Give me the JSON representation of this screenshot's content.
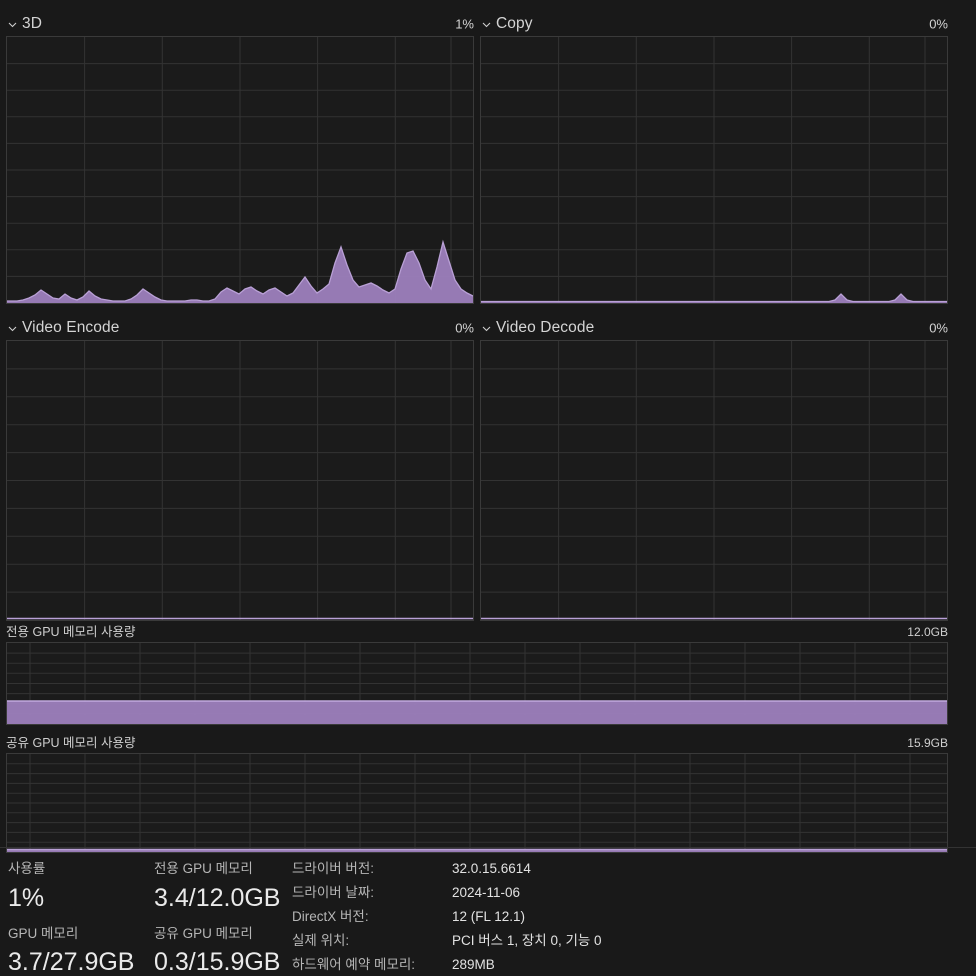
{
  "theme": {
    "background": "#191919",
    "graph_background": "#1b1b1b",
    "graph_border": "#3a3a3a",
    "grid_line": "#333333",
    "accent_fill": "#9d80bd",
    "accent_stroke": "#b9a0d6",
    "text_primary": "#e2e2e2",
    "text_secondary": "#b6b6b6"
  },
  "panels": [
    {
      "id": "3d",
      "icon": "chevron-down-icon",
      "title": "3D",
      "value": "1%"
    },
    {
      "id": "copy",
      "icon": "chevron-down-icon",
      "title": "Copy",
      "value": "0%"
    },
    {
      "id": "video-encode",
      "icon": "chevron-down-icon",
      "title": "Video Encode",
      "value": "0%"
    },
    {
      "id": "video-decode",
      "icon": "chevron-down-icon",
      "title": "Video Decode",
      "value": "0%"
    }
  ],
  "memory_sections": [
    {
      "id": "dedicated",
      "title": "전용 GPU 메모리 사용량",
      "value": "12.0GB"
    },
    {
      "id": "shared",
      "title": "공유 GPU 메모리 사용량",
      "value": "15.9GB"
    }
  ],
  "stats": [
    {
      "id": "utilization",
      "label": "사용률",
      "value": "1%"
    },
    {
      "id": "dedicated-memory",
      "label": "전용 GPU 메모리",
      "value": "3.4/12.0GB"
    },
    {
      "id": "gpu-memory",
      "label": "GPU 메모리",
      "value": "3.7/27.9GB"
    },
    {
      "id": "shared-memory",
      "label": "공유 GPU 메모리",
      "value": "0.3/15.9GB"
    }
  ],
  "details": [
    {
      "id": "driver-version",
      "label": "드라이버 버전:",
      "value": "32.0.15.6614"
    },
    {
      "id": "driver-date",
      "label": "드라이버 날짜:",
      "value": "2024-11-06"
    },
    {
      "id": "directx-version",
      "label": "DirectX 버전:",
      "value": "12 (FL 12.1)"
    },
    {
      "id": "physical-location",
      "label": "실제 위치:",
      "value": "PCI 버스 1, 장치 0, 기능 0"
    },
    {
      "id": "hardware-reserved",
      "label": "하드웨어 예약 메모리:",
      "value": "289MB"
    }
  ],
  "chart_data": [
    {
      "id": "3d",
      "type": "area",
      "title": "3D",
      "ylabel": "utilization %",
      "ylim": [
        0,
        100
      ],
      "current": 1,
      "grid": true,
      "grid_cols": 6,
      "grid_rows": 10,
      "values": [
        0,
        0,
        0,
        0,
        0,
        0,
        1,
        2,
        4,
        2,
        1,
        1,
        2,
        3,
        2,
        1,
        1,
        3,
        4,
        3,
        1,
        0,
        0,
        0,
        0,
        0,
        1,
        2,
        3,
        2,
        1,
        1,
        2,
        3,
        3,
        2,
        1,
        0,
        0,
        0,
        0,
        0,
        0,
        0,
        0,
        0,
        0,
        0,
        0,
        1,
        2,
        3,
        4,
        3,
        2,
        2,
        3,
        4,
        3,
        2,
        2,
        1,
        1,
        0,
        0,
        0,
        0,
        0,
        0,
        1,
        2,
        3,
        3,
        2,
        2,
        3,
        3,
        2,
        2,
        3,
        3,
        2,
        2,
        2,
        3,
        3,
        2,
        2,
        3,
        5,
        4,
        3,
        2,
        2,
        3,
        4,
        6,
        9,
        6,
        4,
        3,
        3,
        3,
        3,
        4,
        4,
        3,
        2,
        2,
        2,
        3,
        4,
        6,
        8,
        9,
        8,
        6,
        4,
        3,
        3,
        4,
        6,
        10,
        8,
        5,
        3,
        3,
        3,
        3,
        2,
        2,
        2,
        1,
        1
      ]
    },
    {
      "id": "copy",
      "type": "area",
      "title": "Copy",
      "ylabel": "utilization %",
      "ylim": [
        0,
        100
      ],
      "current": 0,
      "grid": true,
      "grid_cols": 6,
      "grid_rows": 10,
      "values": [
        0,
        0,
        0,
        0,
        0,
        0,
        0,
        0,
        0,
        0,
        0,
        0,
        0,
        0,
        0,
        0,
        0,
        0,
        0,
        0,
        0,
        0,
        0,
        0,
        0,
        0,
        0,
        0,
        0,
        0,
        0,
        0,
        0,
        0,
        0,
        0,
        0,
        0,
        0,
        0,
        0,
        0,
        0,
        0,
        0,
        0,
        0,
        0,
        0,
        0,
        0,
        0,
        0,
        0,
        0,
        0,
        0,
        0,
        0,
        0,
        0,
        0,
        0,
        0,
        0,
        0,
        0,
        0,
        0,
        0,
        0,
        0,
        0,
        0,
        0,
        0,
        0,
        0,
        0,
        0,
        0,
        0,
        0,
        0,
        0,
        0,
        0,
        0,
        0,
        0,
        0,
        0,
        0,
        0,
        0,
        0,
        0,
        0,
        0,
        0,
        0,
        0,
        0,
        0,
        0,
        0,
        0,
        0,
        0,
        0,
        0,
        0,
        0,
        0,
        0,
        1,
        2,
        1,
        0,
        0,
        0,
        0,
        0,
        0,
        0,
        1,
        2,
        1,
        0,
        0,
        0,
        0,
        0,
        0
      ]
    },
    {
      "id": "video-encode",
      "type": "area",
      "title": "Video Encode",
      "ylabel": "utilization %",
      "ylim": [
        0,
        100
      ],
      "current": 0,
      "grid": true,
      "grid_cols": 6,
      "grid_rows": 10,
      "values": [
        0,
        0,
        0,
        0,
        0,
        0,
        0,
        0,
        0,
        0,
        0,
        0,
        0,
        0,
        0,
        0,
        0,
        0,
        0,
        0,
        0,
        0,
        0,
        0,
        0,
        0,
        0,
        0,
        0,
        0,
        0,
        0,
        0,
        0,
        0,
        0,
        0,
        0,
        0,
        0,
        0,
        0,
        0,
        0,
        0,
        0,
        0,
        0,
        0,
        0,
        0,
        0,
        0,
        0,
        0,
        0,
        0,
        0,
        0,
        0,
        0,
        0,
        0,
        0,
        0,
        0,
        0,
        0,
        0,
        0,
        0,
        0,
        0,
        0,
        0,
        0,
        0,
        0,
        0,
        0,
        0,
        0,
        0,
        0,
        0,
        0,
        0,
        0,
        0,
        0,
        0,
        0,
        0,
        0,
        0,
        0,
        0,
        0,
        0,
        0,
        0,
        0,
        0,
        0,
        0,
        0,
        0,
        0,
        0,
        0,
        0,
        0,
        0,
        0,
        0,
        0,
        0,
        0,
        0,
        0,
        0,
        0,
        0,
        0,
        0,
        0,
        0,
        0
      ]
    },
    {
      "id": "video-decode",
      "type": "area",
      "title": "Video Decode",
      "ylabel": "utilization %",
      "ylim": [
        0,
        100
      ],
      "current": 0,
      "grid": true,
      "grid_cols": 6,
      "grid_rows": 10,
      "values": [
        0,
        0,
        0,
        0,
        0,
        0,
        0,
        0,
        0,
        0,
        0,
        0,
        0,
        0,
        0,
        0,
        0,
        0,
        0,
        0,
        0,
        0,
        0,
        0,
        0,
        0,
        0,
        0,
        0,
        0,
        0,
        0,
        0,
        0,
        0,
        0,
        0,
        0,
        0,
        0,
        0,
        0,
        0,
        0,
        0,
        0,
        0,
        0,
        0,
        0,
        0,
        0,
        0,
        0,
        0,
        0,
        0,
        0,
        0,
        0,
        0,
        0,
        0,
        0,
        0,
        0,
        0,
        0,
        0,
        0,
        0,
        0,
        0,
        0,
        0,
        0,
        0,
        0,
        0,
        0,
        0,
        0,
        0,
        0,
        0,
        0,
        0,
        0,
        0,
        0,
        0,
        0,
        0,
        0,
        0,
        0,
        0,
        0,
        0,
        0,
        0,
        0,
        0,
        0,
        0,
        0,
        0,
        0,
        0,
        0,
        0,
        0,
        0,
        0,
        0,
        0,
        0,
        0,
        0,
        0,
        0,
        0,
        0,
        0,
        0,
        0,
        0,
        0
      ]
    },
    {
      "id": "dedicated-memory",
      "type": "area",
      "title": "전용 GPU 메모리 사용량",
      "ylabel": "GB",
      "ylim": [
        0,
        12.0
      ],
      "current": 3.4,
      "fill_percent": 28.3,
      "grid": true,
      "grid_cols": 17,
      "grid_rows": 7
    },
    {
      "id": "shared-memory",
      "type": "area",
      "title": "공유 GPU 메모리 사용량",
      "ylabel": "GB",
      "ylim": [
        0,
        15.9
      ],
      "current": 0.3,
      "fill_percent": 1.9,
      "grid": true,
      "grid_cols": 17,
      "grid_rows": 10
    }
  ]
}
